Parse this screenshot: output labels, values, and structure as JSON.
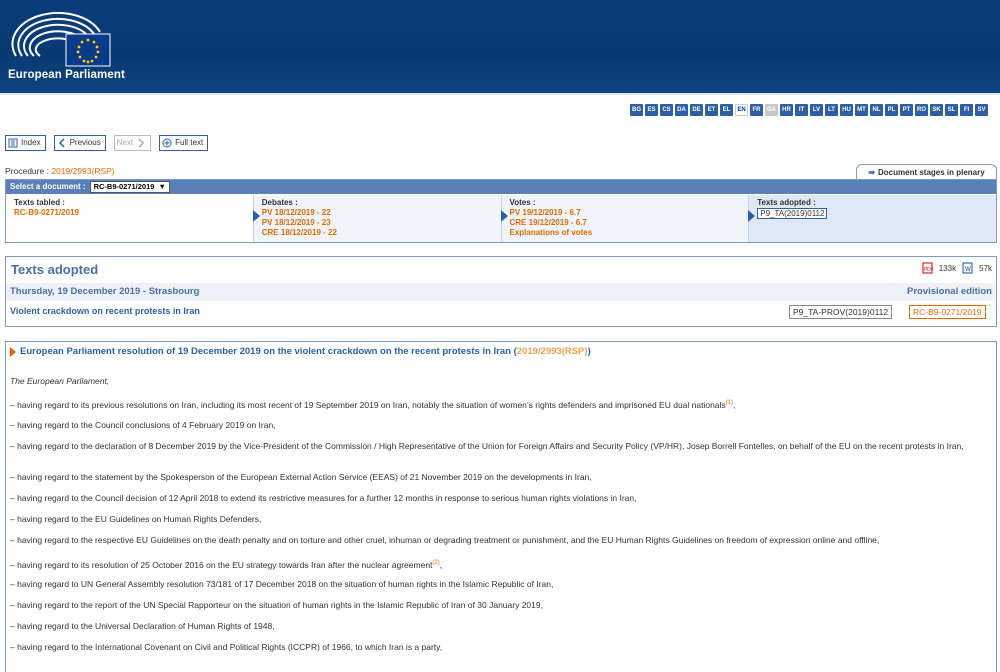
{
  "header": {
    "org_name": "European Parliament"
  },
  "languages": [
    "BG",
    "ES",
    "CS",
    "DA",
    "DE",
    "ET",
    "EL",
    "EN",
    "FR",
    "GA",
    "HR",
    "IT",
    "LV",
    "LT",
    "HU",
    "MT",
    "NL",
    "PL",
    "PT",
    "RO",
    "SK",
    "SL",
    "FI",
    "SV"
  ],
  "active_language": "EN",
  "nav": {
    "index": "Index",
    "previous": "Previous",
    "next": "Next",
    "full_text": "Full text"
  },
  "procedure": {
    "label": "Procedure :",
    "ref": "2019/2993(RSP)"
  },
  "stages_link": "Document stages in plenary",
  "select_document": {
    "label": "Select a document :",
    "value": "RC-B9-0271/2019"
  },
  "stages": [
    {
      "title": "Texts tabled :",
      "links": [
        "RC-B9-0271/2019"
      ]
    },
    {
      "title": "Debates :",
      "links": [
        "PV 18/12/2019 - 22",
        "PV 18/12/2019 - 23",
        "CRE 18/12/2019 - 22"
      ]
    },
    {
      "title": "Votes :",
      "links": [
        "PV 19/12/2019 - 6.7",
        "CRE 19/12/2019 - 6.7",
        "Explanations of votes"
      ]
    },
    {
      "title": "Texts adopted :",
      "links": [
        "P9_TA(2019)0112"
      ]
    }
  ],
  "texts_adopted": {
    "title": "Texts adopted",
    "pdf_size": "133k",
    "word_size": "57k",
    "date": "Thursday, 19 December 2019 - Strasbourg",
    "edition": "Provisional edition",
    "link": "Violent crackdown on recent protests in Iran",
    "ref_prov": "P9_TA-PROV(2019)0112",
    "ref_rc": "RC-B9-0271/2019"
  },
  "resolution": {
    "title": "European Parliament resolution of 19 December 2019 on the violent crackdown on the recent protests in Iran",
    "title_ref": "2019/2993(RSP)",
    "intro": "The European Parliament,",
    "citations": [
      {
        "text": "–  having regard to its previous resolutions on Iran, including its most recent of 19 September 2019 on Iran, notably the situation of women’s rights defenders and imprisoned EU dual nationals",
        "note": "(1)",
        "after": ","
      },
      {
        "text": "–  having regard to the Council conclusions of 4 February 2019 on Iran,",
        "note": "",
        "after": ""
      },
      {
        "text": "–  having regard to the declaration of 8 December 2019 by the Vice-President of the Commission / High Representative of the Union for Foreign Affairs and Security Policy (VP/HR), Josep Borrell Fontelles, on behalf of the EU on the recent protests in Iran,",
        "note": "",
        "after": ""
      },
      {
        "text": "–  having regard to the statement by the Spokesperson of the European External Action Service (EEAS) of 21 November 2019 on the developments in Iran,",
        "note": "",
        "after": ""
      },
      {
        "text": "–  having regard to the Council decision of 12 April 2018 to extend its restrictive measures for a further 12 months in response to serious human rights violations in Iran,",
        "note": "",
        "after": ""
      },
      {
        "text": "–  having regard to the EU Guidelines on Human Rights Defenders,",
        "note": "",
        "after": ""
      },
      {
        "text": "–  having regard to the respective EU Guidelines on the death penalty and on torture and other cruel, inhuman or degrading treatment or punishment, and the EU Human Rights Guidelines on freedom of expression online and offline,",
        "note": "",
        "after": ""
      },
      {
        "text": "–  having regard to its resolution of 25 October 2016 on the EU strategy towards Iran after the nuclear agreement",
        "note": "(2)",
        "after": ","
      },
      {
        "text": "–  having regard to UN General Assembly resolution 73/181 of 17 December 2018 on the situation of human rights in the Islamic Republic of Iran,",
        "note": "",
        "after": ""
      },
      {
        "text": "–  having regard to the report of the UN Special Rapporteur on the situation of human rights in the Islamic Republic of Iran of 30 January 2019,",
        "note": "",
        "after": ""
      },
      {
        "text": "–  having regard to the Universal Declaration of Human Rights of 1948,",
        "note": "",
        "after": ""
      },
      {
        "text": "–  having regard to the International Covenant on Civil and Political Rights (ICCPR) of 1966, to which Iran is a party,",
        "note": "",
        "after": ""
      }
    ]
  }
}
